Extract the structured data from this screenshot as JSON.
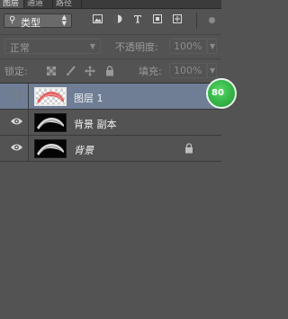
{
  "tabs": [
    {
      "label": "图层",
      "active": true
    },
    {
      "label": "通道",
      "active": false
    },
    {
      "label": "路径",
      "active": false
    }
  ],
  "filter": {
    "search_icon": "search-icon",
    "kind_label": "类型",
    "icons": [
      "image-filter-icon",
      "adjustment-filter-icon",
      "text-filter-icon",
      "shape-filter-icon",
      "smart-object-filter-icon"
    ]
  },
  "blend": {
    "mode_label": "正常",
    "opacity_label": "不透明度:",
    "opacity_value": "100%"
  },
  "lock": {
    "label": "锁定:",
    "icons": [
      "lock-transparent-icon",
      "lock-paint-icon",
      "lock-move-icon",
      "lock-all-icon"
    ],
    "fill_label": "填充:",
    "fill_value": "100%"
  },
  "layers": [
    {
      "name": "图层 1",
      "visible": false,
      "selected": true,
      "thumb": "checker",
      "locked": false
    },
    {
      "name": "背景 副本",
      "visible": true,
      "selected": false,
      "thumb": "dark",
      "locked": false
    },
    {
      "name": "背景",
      "visible": true,
      "selected": false,
      "thumb": "dark",
      "locked": true,
      "italic": true
    }
  ],
  "badge": {
    "text": "80"
  },
  "colors": {
    "panel_bg": "#535353",
    "selected_row": "#6f7e95",
    "badge_green": "#34b446",
    "thumb_red": "#e04848"
  }
}
